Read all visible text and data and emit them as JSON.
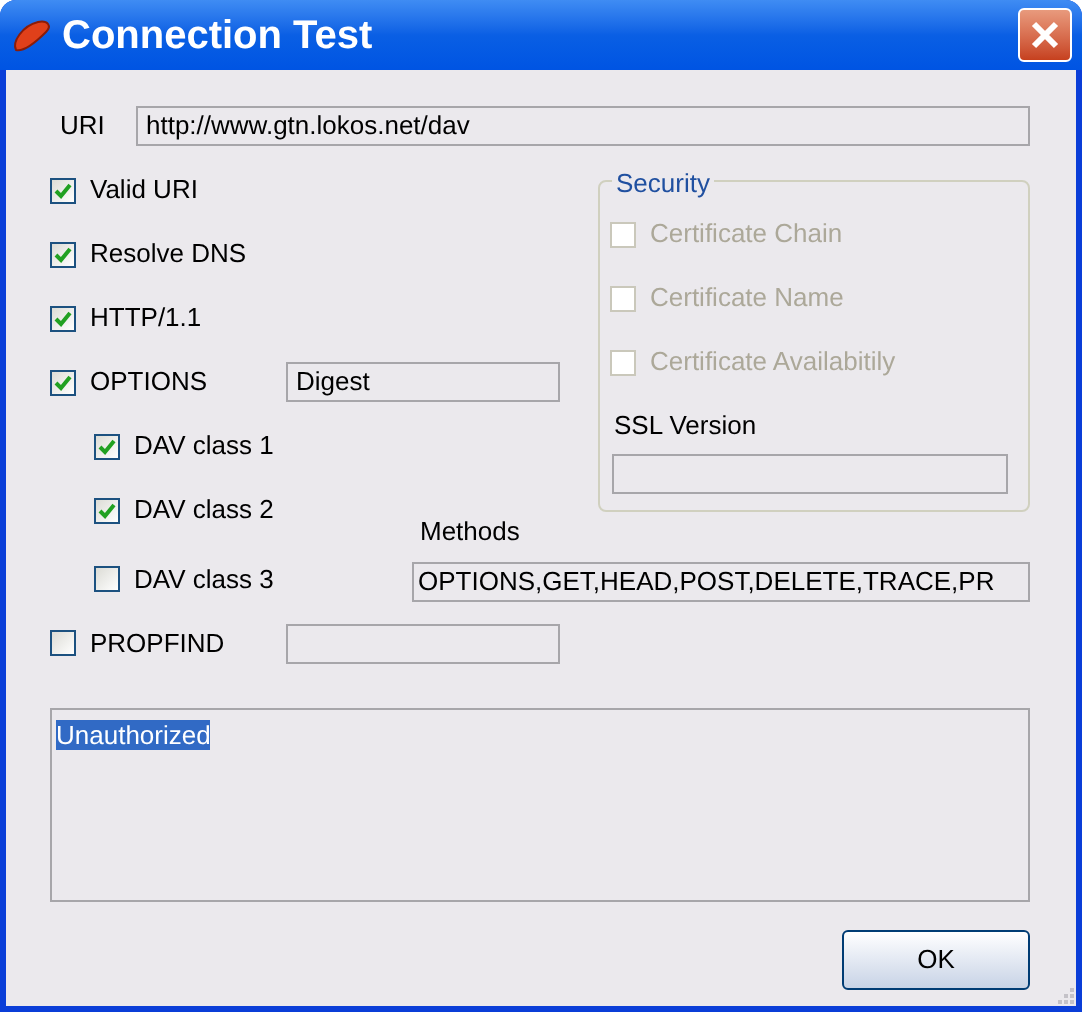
{
  "window": {
    "title": "Connection Test"
  },
  "uri": {
    "label": "URI",
    "value": "http://www.gtn.lokos.net/dav"
  },
  "checks": [
    {
      "label": "Valid URI",
      "checked": true
    },
    {
      "label": "Resolve DNS",
      "checked": true
    },
    {
      "label": "HTTP/1.1",
      "checked": true
    },
    {
      "label": "OPTIONS",
      "checked": true,
      "kind": "with-field",
      "value": "Digest",
      "children": [
        {
          "label": "DAV class 1",
          "checked": true
        },
        {
          "label": "DAV class 2",
          "checked": true
        },
        {
          "label": "DAV class 3",
          "checked": false
        }
      ]
    },
    {
      "label": "PROPFIND",
      "checked": false,
      "kind": "with-field"
    }
  ],
  "security": {
    "title": "Security",
    "checks": [
      {
        "label": "Certificate Chain",
        "checked": false,
        "disabled": true
      },
      {
        "label": "Certificate Name",
        "checked": false,
        "disabled": true
      },
      {
        "label": "Certificate Availabitily",
        "checked": false,
        "disabled": true
      }
    ],
    "ssl_version": {
      "label": "SSL Version"
    }
  },
  "methods": {
    "label": "Methods",
    "value": "OPTIONS,GET,HEAD,POST,DELETE,TRACE,PR"
  },
  "status": {
    "text": "Unauthorized",
    "selected": true
  },
  "buttons": [
    "OK"
  ]
}
